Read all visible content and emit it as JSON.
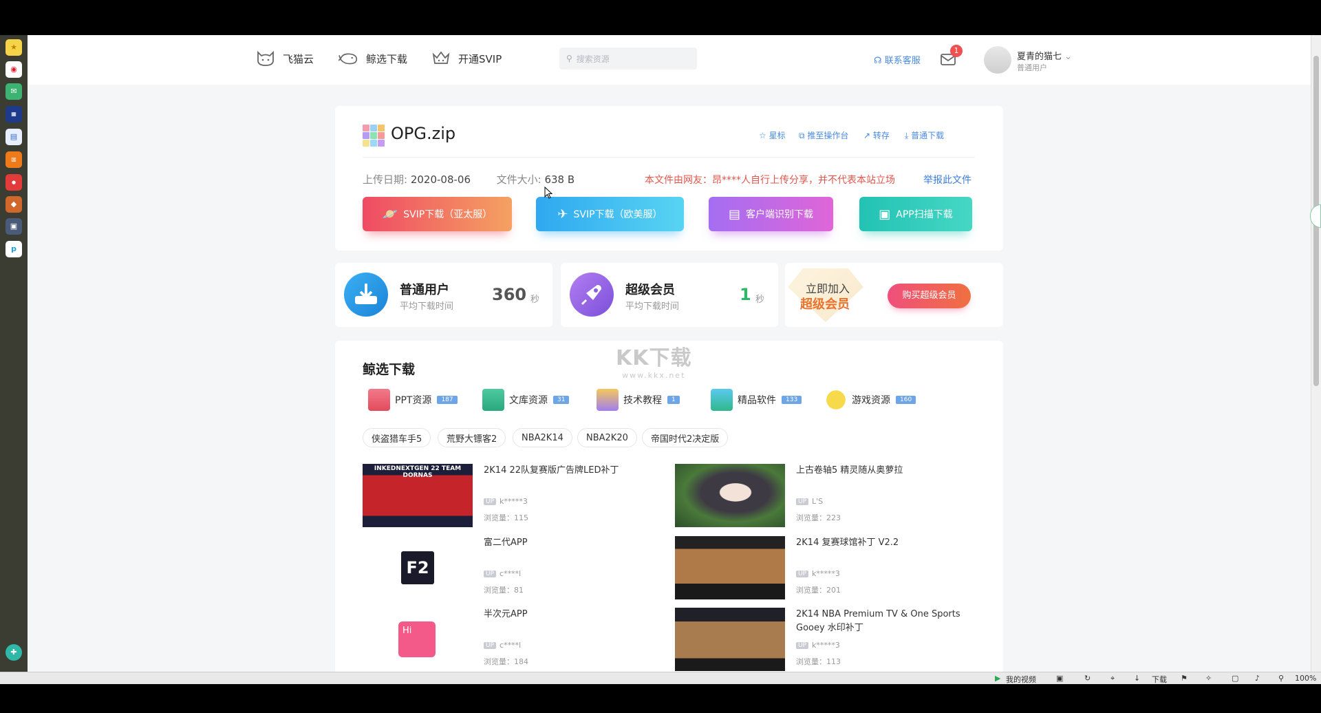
{
  "taskbar_left": {
    "icons": [
      "star-icon",
      "weibo-icon",
      "mail-icon",
      "news-icon",
      "document-icon",
      "novel-icon",
      "xiaohongshu-icon",
      "game-icon",
      "game2-icon",
      "app-icon",
      "browser-icon"
    ]
  },
  "nav": {
    "logo_label": "飞猫云",
    "whale_label": "鲸选下载",
    "svip_label": "开通SVIP",
    "search_placeholder": "搜索资源",
    "contact_label": "联系客服",
    "mail_badge": "1",
    "user_name": "夏青的猫七",
    "user_role": "普通用户"
  },
  "file": {
    "name": "OPG.zip",
    "actions": [
      "星标",
      "推至操作台",
      "转存",
      "普通下载"
    ],
    "upload_label": "上传日期:",
    "upload_date": "2020-08-06",
    "size_label": "文件大小:",
    "size": "638 B",
    "notice": "本文件由网友：昂****人自行上传分享，并不代表本站立场",
    "report": "举报此文件",
    "buttons": [
      "SVIP下载（亚太服）",
      "SVIP下载（欧美服）",
      "客户端识别下载",
      "APP扫描下载"
    ]
  },
  "stats": {
    "normal_title": "普通用户",
    "normal_sub": "平均下载时间",
    "normal_value": "360",
    "normal_unit": "秒",
    "super_title": "超级会员",
    "super_sub": "平均下载时间",
    "super_value": "1",
    "super_unit": "秒",
    "join_line1": "立即加入",
    "join_line2": "超级会员",
    "buy_label": "购买超级会员"
  },
  "watermark": {
    "line1": "KK下载",
    "line2": "www.kkx.net"
  },
  "selection": {
    "title": "鲸选下载",
    "categories": [
      {
        "label": "PPT资源",
        "count": "187"
      },
      {
        "label": "文库资源",
        "count": "31"
      },
      {
        "label": "技术教程",
        "count": "1"
      },
      {
        "label": "精品软件",
        "count": "133"
      },
      {
        "label": "游戏资源",
        "count": "160"
      }
    ],
    "tags": [
      "侠盗猎车手5",
      "荒野大镖客2",
      "NBA2K14",
      "NBA2K20",
      "帝国时代2决定版"
    ],
    "items": [
      {
        "title": "2K14 22队复赛版广告牌LED补丁",
        "up": "k*****3",
        "views": "浏览量：115",
        "thumb_text": "INKEDNEXTGEN 22 TEAM DORNAS"
      },
      {
        "title": "上古卷轴5 精灵随从奥萝拉",
        "up": "L'S",
        "views": "浏览量：223"
      },
      {
        "title": "富二代APP",
        "up": "c****l",
        "views": "浏览量：81",
        "thumb_text": "F2"
      },
      {
        "title": "2K14 复赛球馆补丁 V2.2",
        "up": "k*****3",
        "views": "浏览量：201"
      },
      {
        "title": "半次元APP",
        "up": "c****l",
        "views": "浏览量：184",
        "thumb_text": "Hi"
      },
      {
        "title": "2K14 NBA Premium TV & One Sports Gooey 水印补丁",
        "up": "k*****3",
        "views": "浏览量：113"
      }
    ],
    "up_tag": "UP"
  },
  "statusbar": {
    "video": "我的视频",
    "download": "下载",
    "zoom": "100%"
  },
  "colors": {
    "accent_blue": "#4a8ae0",
    "notice_red": "#e2554a",
    "svip_asia": "#ef4b63",
    "svip_eu": "#39b4f1",
    "client": "#c159e8",
    "app": "#2ccbb9"
  }
}
